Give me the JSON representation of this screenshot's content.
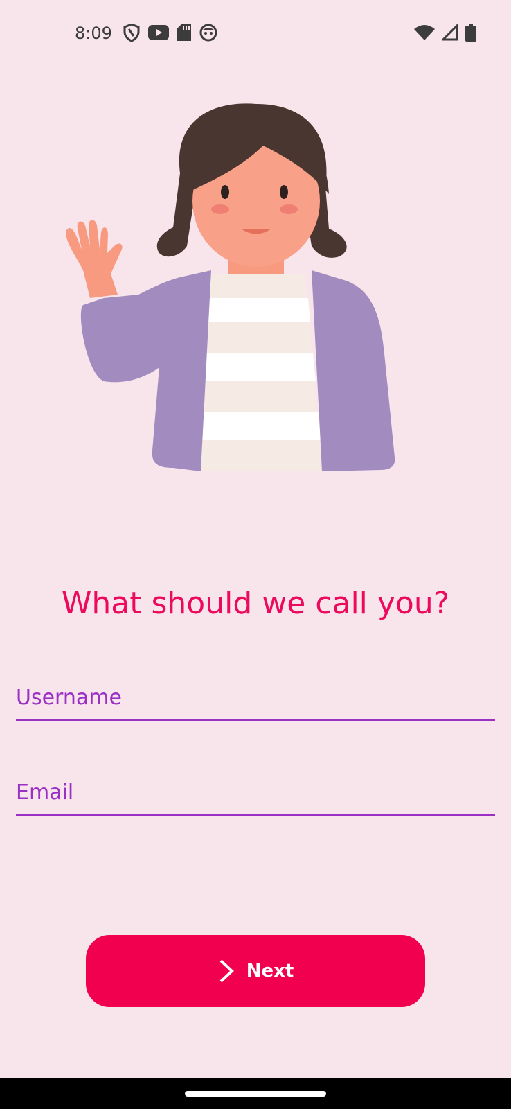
{
  "status_bar": {
    "time": "8:09",
    "left_icons": [
      "shield-icon",
      "youtube-icon",
      "sd-card-icon",
      "face-icon"
    ],
    "right_icons": [
      "wifi-icon",
      "signal-icon",
      "battery-icon"
    ]
  },
  "heading": "What should we call you?",
  "form": {
    "username_placeholder": "Username",
    "email_placeholder": "Email"
  },
  "next_button": {
    "label": "Next",
    "icon": "chevron-right-icon"
  },
  "colors": {
    "background": "#f8e5ec",
    "accent": "#ec0a5d",
    "button": "#f0004f",
    "field": "#9b30c4"
  }
}
